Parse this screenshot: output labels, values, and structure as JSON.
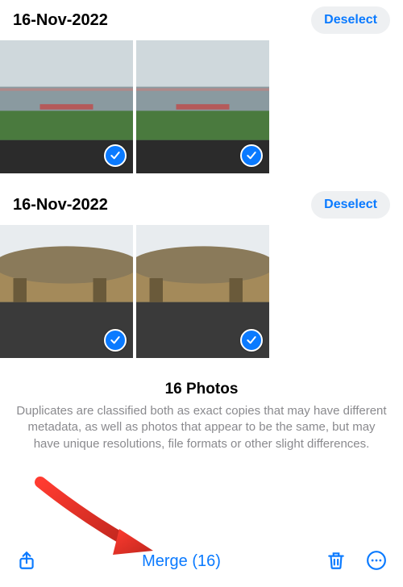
{
  "groups": [
    {
      "date": "16-Nov-2022",
      "deselect_label": "Deselect",
      "thumb_alt_0": "Stadium photo duplicate 1",
      "thumb_alt_1": "Stadium photo duplicate 2"
    },
    {
      "date": "16-Nov-2022",
      "deselect_label": "Deselect",
      "thumb_alt_0": "Arena photo duplicate 1",
      "thumb_alt_1": "Arena photo duplicate 2"
    }
  ],
  "summary": {
    "title": "16 Photos",
    "text": "Duplicates are classified both as exact copies that may have different metadata, as well as photos that appear to be the same, but may have unique resolutions, file formats or other slight differences."
  },
  "toolbar": {
    "merge_label": "Merge (16)"
  }
}
